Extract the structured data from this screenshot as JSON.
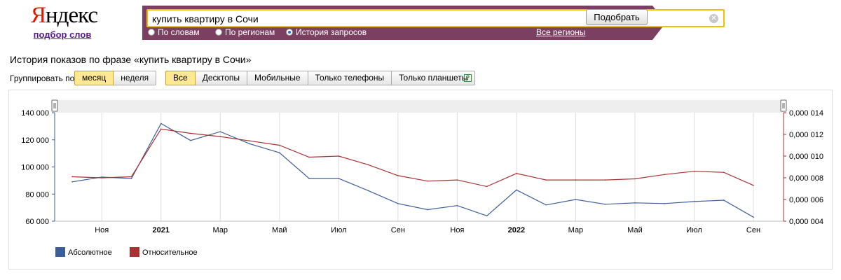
{
  "logo": {
    "text": "Яндекс",
    "first_letter": "Я",
    "rest": "ндекс",
    "subtitle": "подбор слов"
  },
  "search": {
    "value": "купить квартиру в Сочи",
    "button_label": "Подобрать",
    "clear_icon": "clear-icon",
    "modes": [
      {
        "label": "По словам",
        "checked": false
      },
      {
        "label": "По регионам",
        "checked": false
      },
      {
        "label": "История запросов",
        "checked": true
      }
    ],
    "regions_link": "Все регионы",
    "bar_color": "#7b3f62",
    "field_border_color": "#f0c000"
  },
  "page_title": "История показов по фразе «купить квартиру в Сочи»",
  "controls": {
    "group_label": "Группировать по:",
    "group_buttons": [
      {
        "label": "месяц",
        "active": true
      },
      {
        "label": "неделя",
        "active": false
      }
    ],
    "device_buttons": [
      {
        "label": "Все",
        "active": true
      },
      {
        "label": "Десктопы",
        "active": false
      },
      {
        "label": "Мобильные",
        "active": false
      },
      {
        "label": "Только телефоны",
        "active": false
      },
      {
        "label": "Только планшеты",
        "active": false
      }
    ],
    "help_icon": "?"
  },
  "chart_data": {
    "type": "line",
    "title": "",
    "xlabel": "",
    "ylabel": "",
    "x": [
      "2020-10",
      "2020-11",
      "2020-12",
      "2021-01",
      "2021-02",
      "2021-03",
      "2021-04",
      "2021-05",
      "2021-06",
      "2021-07",
      "2021-08",
      "2021-09",
      "2021-10",
      "2021-11",
      "2021-12",
      "2022-01",
      "2022-02",
      "2022-03",
      "2022-04",
      "2022-05",
      "2022-06",
      "2022-07",
      "2022-08",
      "2022-09"
    ],
    "x_tick_labels": [
      {
        "x": "2020-11",
        "label": "Ноя",
        "bold": false
      },
      {
        "x": "2021-01",
        "label": "2021",
        "bold": true
      },
      {
        "x": "2021-03",
        "label": "Мар",
        "bold": false
      },
      {
        "x": "2021-05",
        "label": "Май",
        "bold": false
      },
      {
        "x": "2021-07",
        "label": "Июл",
        "bold": false
      },
      {
        "x": "2021-09",
        "label": "Сен",
        "bold": false
      },
      {
        "x": "2021-11",
        "label": "Ноя",
        "bold": false
      },
      {
        "x": "2022-01",
        "label": "2022",
        "bold": true
      },
      {
        "x": "2022-03",
        "label": "Мар",
        "bold": false
      },
      {
        "x": "2022-05",
        "label": "Май",
        "bold": false
      },
      {
        "x": "2022-07",
        "label": "Июл",
        "bold": false
      },
      {
        "x": "2022-09",
        "label": "Сен",
        "bold": false
      }
    ],
    "y_left": {
      "ylim": [
        60000,
        140000
      ],
      "ticks": [
        "60 000",
        "80 000",
        "100 000",
        "120 000",
        "140 000"
      ],
      "tick_values": [
        60000,
        80000,
        100000,
        120000,
        140000
      ]
    },
    "y_right": {
      "ylim": [
        0.004,
        0.014
      ],
      "ticks": [
        "0,000 004",
        "0,000 006",
        "0,000 008",
        "0,000 010",
        "0,000 012",
        "0,000 014"
      ],
      "tick_values": [
        0.004,
        0.006,
        0.008,
        0.01,
        0.012,
        0.014
      ]
    },
    "grid": true,
    "legend_position": "bottom-left",
    "series": [
      {
        "name": "Абсолютное",
        "axis": "left",
        "color": "#3d5e9c",
        "values": [
          89000,
          92500,
          91500,
          132000,
          119500,
          126000,
          117000,
          110500,
          91500,
          91500,
          82500,
          73000,
          68500,
          71500,
          64000,
          83000,
          72000,
          76000,
          72500,
          73500,
          73000,
          74500,
          75500,
          63000
        ]
      },
      {
        "name": "Относительное",
        "axis": "right",
        "color": "#a83232",
        "values": [
          0.0081,
          0.008,
          0.0081,
          0.0125,
          0.0121,
          0.0118,
          0.0114,
          0.011,
          0.0099,
          0.01,
          0.0092,
          0.0082,
          0.0077,
          0.0078,
          0.0072,
          0.0084,
          0.0078,
          0.0078,
          0.0078,
          0.0079,
          0.0083,
          0.0086,
          0.0085,
          0.0073
        ]
      }
    ]
  }
}
